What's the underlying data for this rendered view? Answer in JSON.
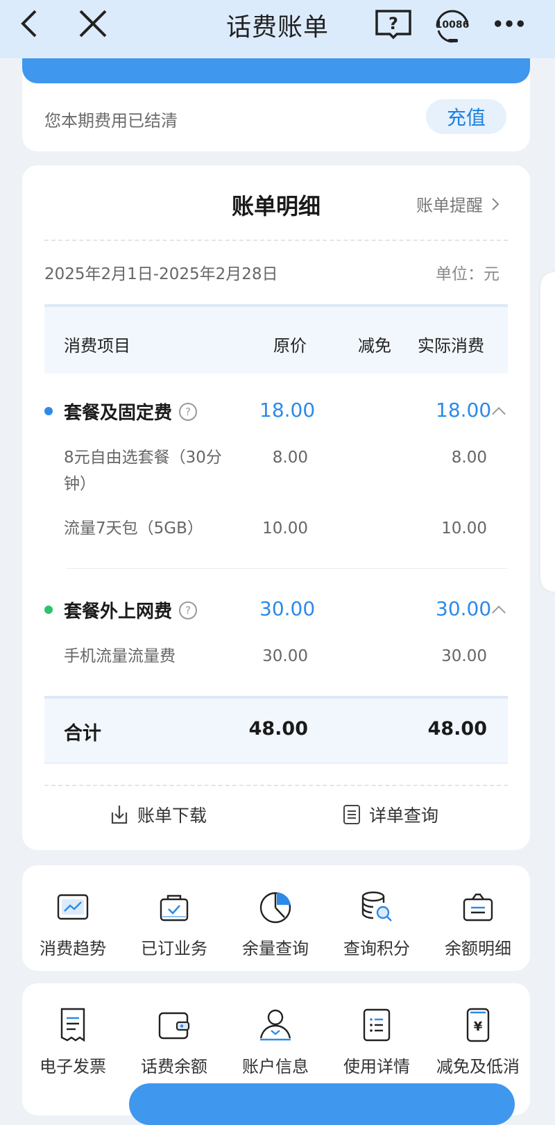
{
  "header": {
    "title": "话费账单",
    "hotline_label": "10086",
    "help_label": "?"
  },
  "status": {
    "text": "您本期费用已结清",
    "recharge_label": "充值"
  },
  "bill": {
    "title": "账单明细",
    "remind_label": "账单提醒",
    "period": "2025年2月1日-2025年2月28日",
    "unit": "单位：元",
    "columns": {
      "item": "消费项目",
      "original": "原价",
      "discount": "减免",
      "actual": "实际消费"
    },
    "groups": [
      {
        "name": "套餐及固定费",
        "dot_color": "#2d8ae8",
        "original": "18.00",
        "actual": "18.00",
        "items": [
          {
            "name": "8元自由选套餐（30分钟）",
            "original": "8.00",
            "actual": "8.00"
          },
          {
            "name": "流量7天包（5GB）",
            "original": "10.00",
            "actual": "10.00"
          }
        ]
      },
      {
        "name": "套餐外上网费",
        "dot_color": "#2cc36b",
        "original": "30.00",
        "actual": "30.00",
        "items": [
          {
            "name": "手机流量流量费",
            "original": "30.00",
            "actual": "30.00"
          }
        ]
      }
    ],
    "total": {
      "label": "合计",
      "original": "48.00",
      "actual": "48.00"
    },
    "actions": {
      "download": "账单下载",
      "detail_query": "详单查询"
    }
  },
  "shortcuts_row1": [
    {
      "label": "消费趋势",
      "icon": "trend-chart-icon"
    },
    {
      "label": "已订业务",
      "icon": "subscribed-bag-icon"
    },
    {
      "label": "余量查询",
      "icon": "pie-clock-icon"
    },
    {
      "label": "查询积分",
      "icon": "coins-search-icon"
    },
    {
      "label": "余额明细",
      "icon": "balance-bag-icon"
    }
  ],
  "shortcuts_row2": [
    {
      "label": "电子发票",
      "icon": "invoice-icon"
    },
    {
      "label": "话费余额",
      "icon": "wallet-icon"
    },
    {
      "label": "账户信息",
      "icon": "user-icon"
    },
    {
      "label": "使用详情",
      "icon": "list-doc-icon"
    },
    {
      "label": "减免及低消",
      "icon": "phone-yuan-icon"
    }
  ],
  "colors": {
    "accent": "#2d8ae8",
    "header_bg": "#dcebfb",
    "brand_blue": "#3f97ee"
  }
}
